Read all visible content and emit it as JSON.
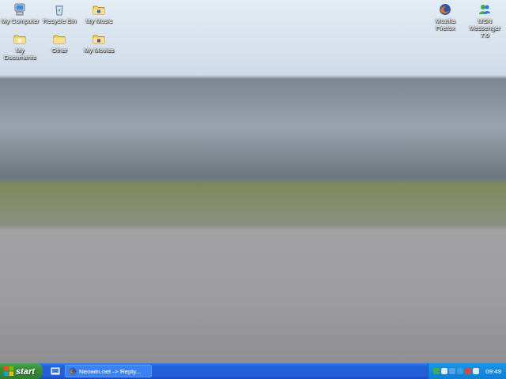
{
  "desktop": {
    "wallpaper": {
      "kind": "photo"
    },
    "icons_left": [
      {
        "label": "My Computer",
        "kind": "computer"
      },
      {
        "label": "Recycle Bin",
        "kind": "recycle"
      },
      {
        "label": "My Music",
        "kind": "folder-music"
      },
      {
        "label": "My Documents",
        "kind": "folder-docs"
      },
      {
        "label": "Other",
        "kind": "folder"
      },
      {
        "label": "My Movies",
        "kind": "folder-movies"
      }
    ],
    "icons_right": [
      {
        "label": "Mozilla Firefox",
        "kind": "firefox"
      },
      {
        "label": "MSN Messenger 7.0",
        "kind": "msn"
      }
    ]
  },
  "taskbar": {
    "start": "start",
    "tasks": [
      {
        "label": "Neowin.net -> Reply...",
        "selected": false
      }
    ],
    "clock": "09:49"
  }
}
